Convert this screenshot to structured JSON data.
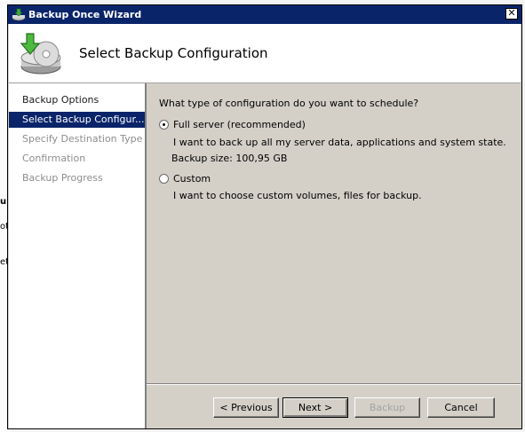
{
  "window": {
    "title": "Backup Once Wizard",
    "close_glyph": "✕"
  },
  "header": {
    "title": "Select Backup Configuration",
    "icon": "backup-disk-icon"
  },
  "nav": {
    "items": [
      {
        "label": "Backup Options",
        "state": "done"
      },
      {
        "label": "Select Backup Configur...",
        "state": "active"
      },
      {
        "label": "Specify Destination Type",
        "state": "pending"
      },
      {
        "label": "Confirmation",
        "state": "pending"
      },
      {
        "label": "Backup Progress",
        "state": "pending"
      }
    ]
  },
  "main": {
    "question": "What type of configuration do you want to schedule?",
    "options": [
      {
        "label": "Full server (recommended)",
        "description": "I want to back up all my server data, applications and system state.",
        "size": "Backup size: 100,95 GB",
        "selected": true
      },
      {
        "label": "Custom",
        "description": "I want to choose custom volumes, files for backup.",
        "selected": false
      }
    ]
  },
  "buttons": {
    "previous": "< Previous",
    "next": "Next >",
    "backup": "Backup",
    "cancel": "Cancel"
  },
  "background": {
    "fragments": [
      "up",
      "ot",
      "et."
    ]
  },
  "colors": {
    "titlebar": "#0a246a",
    "selection": "#0a246a",
    "face": "#d4d0c8"
  }
}
